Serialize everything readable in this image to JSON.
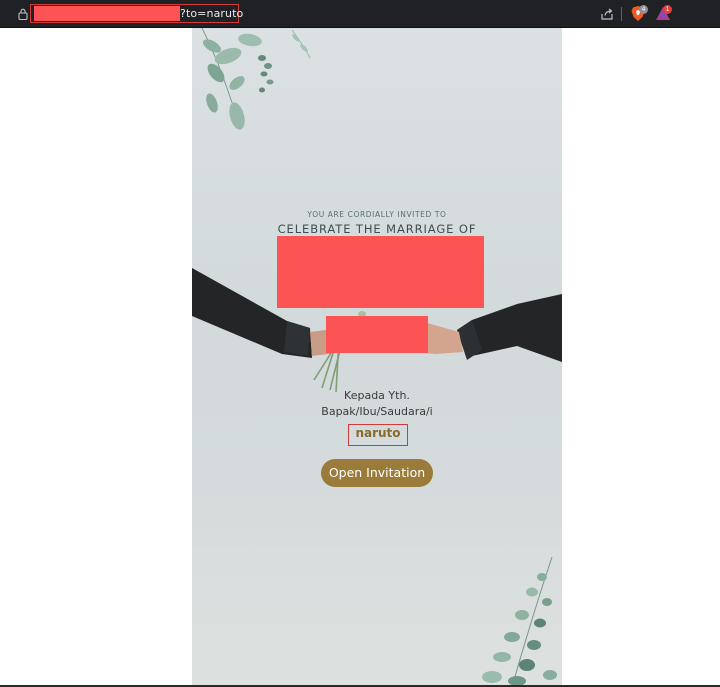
{
  "browser": {
    "url_suffix": "?to=naruto",
    "brave_shields_count": "4",
    "rewards_count": "1"
  },
  "invitation": {
    "subtitle": "YOU ARE CORDIALLY INVITED TO",
    "title": "CELEBRATE THE MARRIAGE OF",
    "recipient_line1": "Kepada Yth.",
    "recipient_line2": "Bapak/Ibu/Saudara/i",
    "guest_name": "naruto",
    "open_button_label": "Open Invitation"
  },
  "colors": {
    "redaction": "#fc5454",
    "button": "#9a7b3a",
    "guest_name": "#8a6b2a",
    "highlight_border": "#d23a3a"
  }
}
